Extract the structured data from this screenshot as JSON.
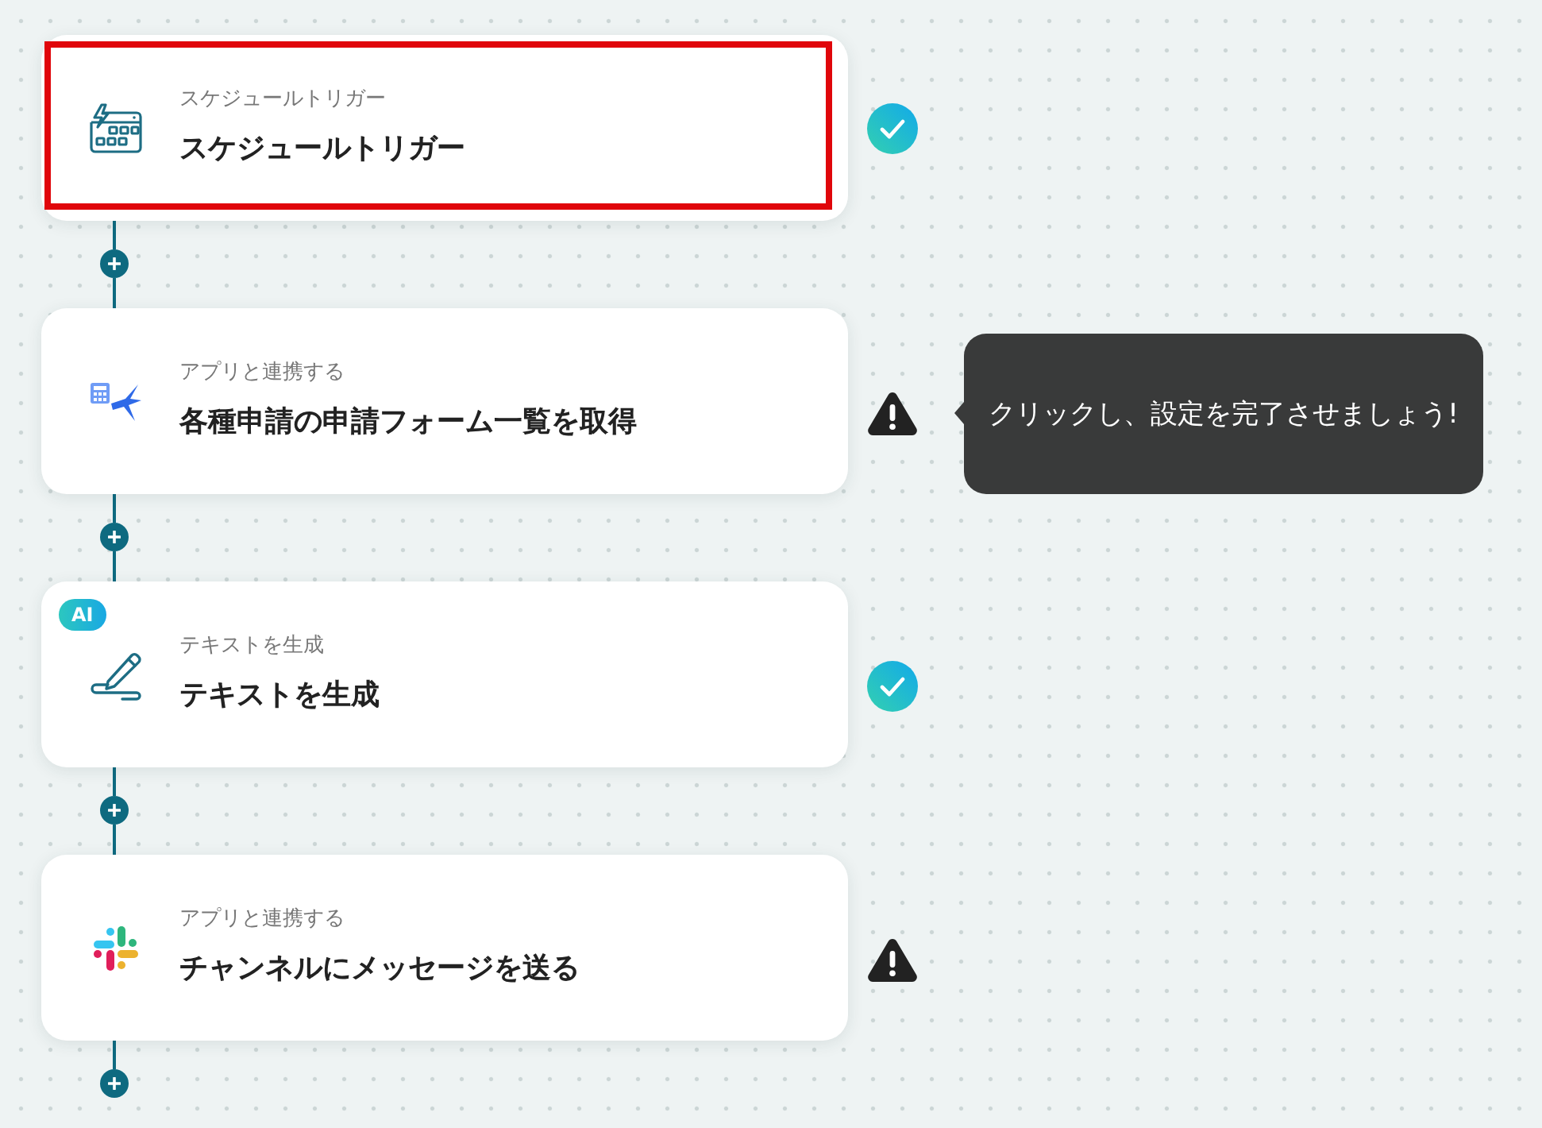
{
  "steps": [
    {
      "kind": "schedule",
      "selected": true,
      "subtitle": "スケジュールトリガー",
      "title": "スケジュールトリガー",
      "done": true
    },
    {
      "kind": "form-app",
      "selected": false,
      "subtitle": "アプリと連携する",
      "title": "各種申請の申請フォーム一覧を取得",
      "done": false,
      "tooltip": "クリックし、設定を完了させましょう!"
    },
    {
      "kind": "ai-text",
      "selected": false,
      "badge": "AI",
      "subtitle": "テキストを生成",
      "title": "テキストを生成",
      "done": true
    },
    {
      "kind": "chat-app",
      "selected": false,
      "subtitle": "アプリと連携する",
      "title": "チャンネルにメッセージを送る",
      "done": false
    }
  ]
}
